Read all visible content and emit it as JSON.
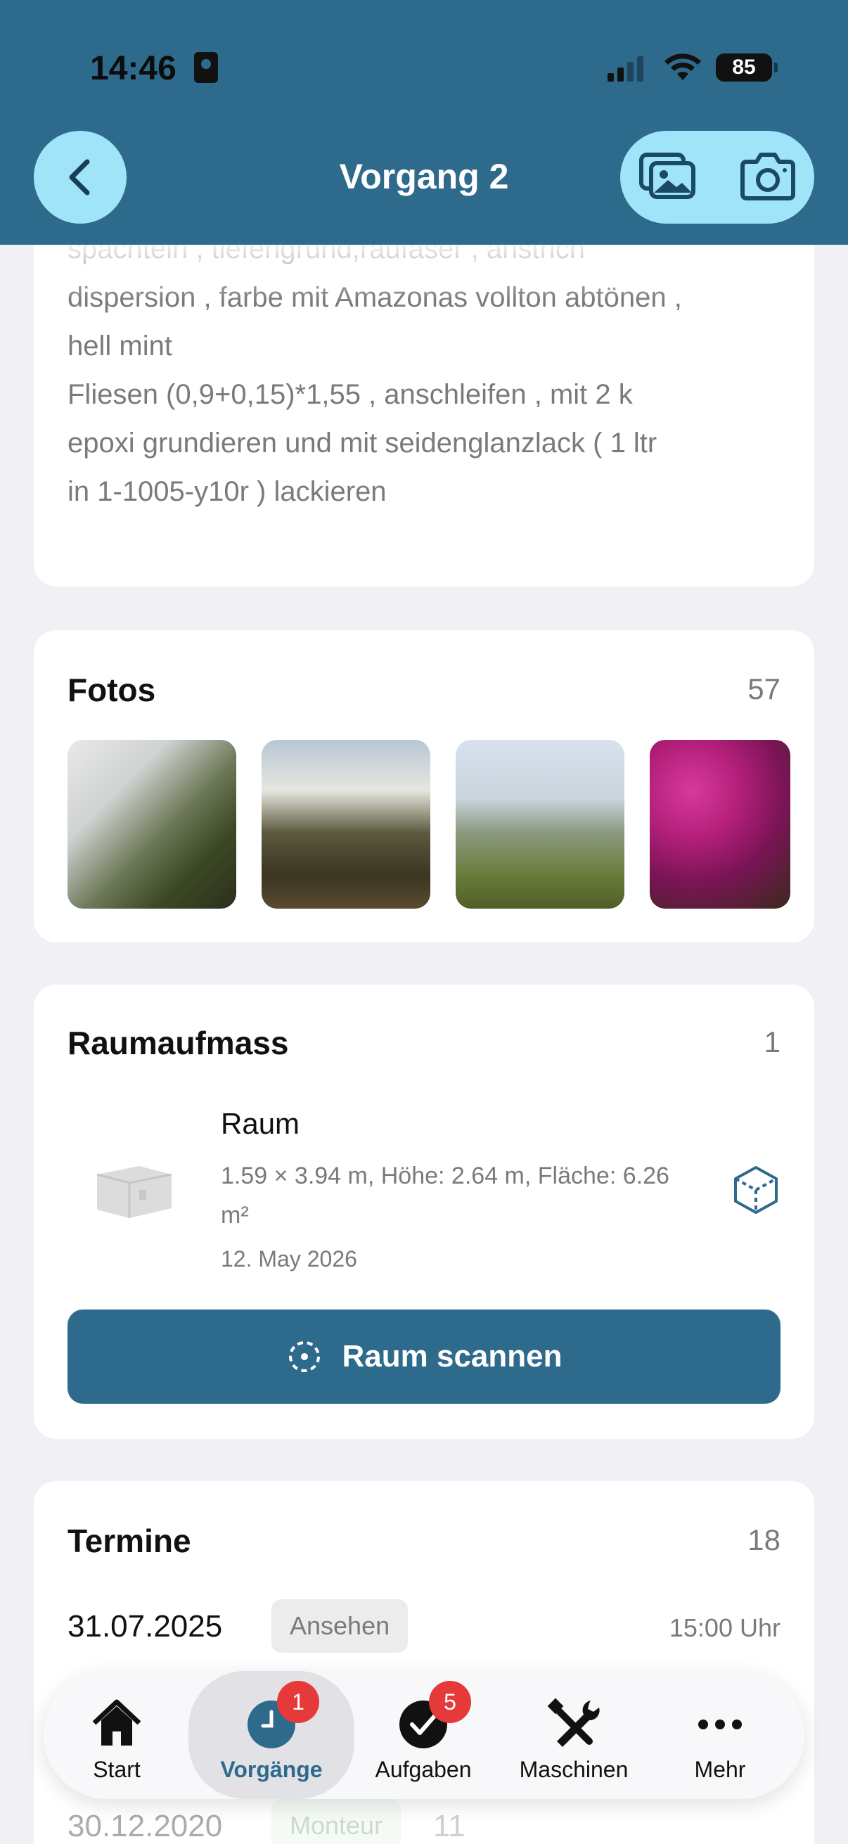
{
  "status_bar": {
    "time": "14:46",
    "battery": "85"
  },
  "header": {
    "title": "Vorgang 2"
  },
  "description": {
    "text": "spachteln , tiefengrund,raufaser , anstrich\ndispersion , farbe mit Amazonas vollton abtönen ,\nhell mint\nFliesen (0,9+0,15)*1,55  , anschleifen , mit 2 k\nepoxi grundieren und mit seidenglanzlack ( 1 ltr\nin 1-1005-y10r ) lackieren"
  },
  "photos": {
    "title": "Fotos",
    "count": "57"
  },
  "room_measure": {
    "title": "Raumaufmass",
    "count": "1",
    "room": {
      "name": "Raum",
      "dimensions": "1.59 × 3.94 m, Höhe: 2.64 m, Fläche: 6.26 m²",
      "date": "12. May 2026"
    },
    "scan_button": "Raum scannen"
  },
  "appointments": {
    "title": "Termine",
    "count": "18",
    "rows": [
      {
        "date": "31.07.2025",
        "tag": "Ansehen",
        "time": "15:00 Uhr"
      },
      {
        "date": "30.12.2020",
        "tag": "Monteur",
        "time": "11"
      }
    ]
  },
  "tabbar": {
    "items": [
      {
        "label": "Start",
        "icon": "house-icon"
      },
      {
        "label": "Vorgänge",
        "icon": "clock-icon",
        "badge": "1"
      },
      {
        "label": "Aufgaben",
        "icon": "checkmark-icon",
        "badge": "5"
      },
      {
        "label": "Maschinen",
        "icon": "tools-icon"
      },
      {
        "label": "Mehr",
        "icon": "more-icon"
      }
    ]
  },
  "colors": {
    "primary": "#2e6a8c",
    "accent": "#9fe4f8",
    "badge": "#e5393a"
  }
}
